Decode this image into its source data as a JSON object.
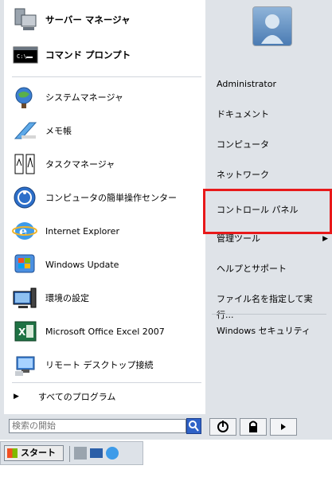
{
  "pinned": [
    {
      "label": "サーバー マネージャ",
      "icon": "server-manager-icon"
    },
    {
      "label": "コマンド プロンプト",
      "icon": "command-prompt-icon"
    }
  ],
  "recent": [
    {
      "label": "システムマネージャ",
      "icon": "system-manager-icon"
    },
    {
      "label": "メモ帳",
      "icon": "notepad-icon"
    },
    {
      "label": "タスクマネージャ",
      "icon": "task-manager-icon"
    },
    {
      "label": "コンピュータの簡単操作センター",
      "icon": "ease-of-access-icon"
    },
    {
      "label": "Internet Explorer",
      "icon": "internet-explorer-icon"
    },
    {
      "label": "Windows Update",
      "icon": "windows-update-icon"
    },
    {
      "label": "環境の設定",
      "icon": "environment-settings-icon"
    },
    {
      "label": "Microsoft Office Excel 2007",
      "icon": "excel-icon"
    },
    {
      "label": "リモート デスクトップ接続",
      "icon": "remote-desktop-icon"
    }
  ],
  "all_programs": "すべてのプログラム",
  "search": {
    "placeholder": "検索の開始"
  },
  "right": [
    {
      "label": "Administrator"
    },
    {
      "label": "ドキュメント"
    },
    {
      "label": "コンピュータ"
    },
    {
      "label": "ネットワーク"
    },
    {
      "label": "コントロール パネル"
    },
    {
      "label": "管理ツール"
    },
    {
      "label": "ヘルプとサポート"
    },
    {
      "label": "ファイル名を指定して実行..."
    },
    {
      "label": "Windows セキュリティ"
    }
  ],
  "taskbar": {
    "start_label": "スタート"
  }
}
